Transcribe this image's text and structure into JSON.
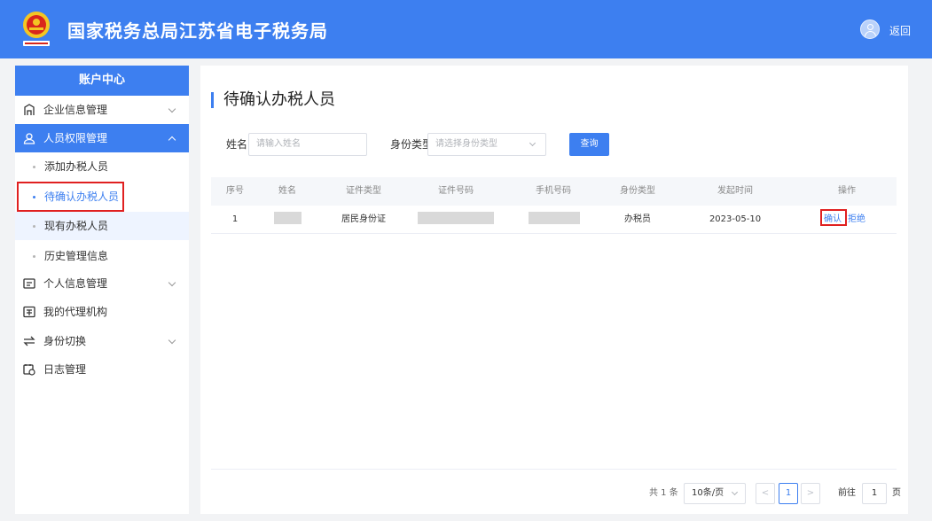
{
  "header": {
    "title": "国家税务总局江苏省电子税务局",
    "back_label": "返回"
  },
  "sidebar": {
    "title": "账户中心",
    "items": [
      {
        "label": "企业信息管理",
        "icon": "building-icon"
      },
      {
        "label": "人员权限管理",
        "icon": "user-shield-icon"
      },
      {
        "label": "个人信息管理",
        "icon": "id-card-icon"
      },
      {
        "label": "我的代理机构",
        "icon": "agency-icon"
      },
      {
        "label": "身份切换",
        "icon": "switch-icon"
      },
      {
        "label": "日志管理",
        "icon": "calendar-log-icon"
      }
    ],
    "subitems": [
      {
        "label": "添加办税人员"
      },
      {
        "label": "待确认办税人员"
      },
      {
        "label": "现有办税人员"
      },
      {
        "label": "历史管理信息"
      }
    ]
  },
  "main": {
    "title": "待确认办税人员",
    "filters": {
      "name_label": "姓名",
      "name_placeholder": "请输入姓名",
      "type_label": "身份类型",
      "type_placeholder": "请选择身份类型",
      "search_label": "查询"
    },
    "table": {
      "columns": [
        "序号",
        "姓名",
        "证件类型",
        "证件号码",
        "手机号码",
        "身份类型",
        "发起时间",
        "操作"
      ],
      "rows": [
        {
          "index": "1",
          "name": "",
          "id_type": "居民身份证",
          "id_number": "",
          "phone": "",
          "role": "办税员",
          "time": "2023-05-10",
          "confirm": "确认",
          "reject": "拒绝"
        }
      ]
    },
    "pagination": {
      "total": "共 1 条",
      "page_size": "10条/页",
      "prev": "<",
      "current": "1",
      "next": ">",
      "goto_prefix": "前往",
      "goto_value": "1",
      "goto_suffix": "页"
    }
  },
  "colors": {
    "primary": "#3d7ff0",
    "highlight_border": "#e02020"
  }
}
